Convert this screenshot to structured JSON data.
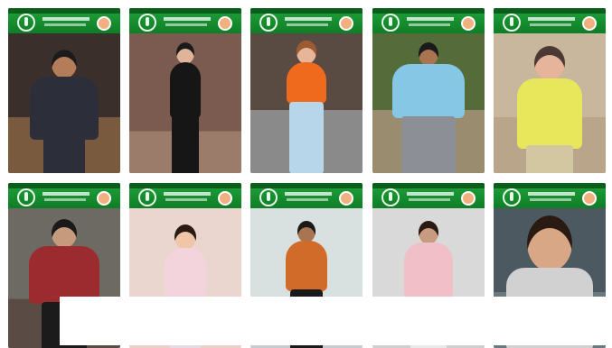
{
  "tiles": [
    {
      "id": "row1-col1",
      "bg": "#3a2f2a",
      "floor": "#7a5a3e",
      "skin": "#b57c5a",
      "hair": "#1b1b1b",
      "top": "#2c2f3a",
      "legs": "#2c2f3a"
    },
    {
      "id": "row1-col2",
      "bg": "#7b5a4f",
      "floor": "#9b7c6a",
      "skin": "#e0b49a",
      "hair": "#1a1a1a",
      "top": "#161616",
      "legs": "#161616"
    },
    {
      "id": "row1-col3",
      "bg": "#5a4b42",
      "floor": "#8a8a8a",
      "skin": "#e6b59a",
      "hair": "#9b5a30",
      "top": "#f06a1d",
      "legs": "#b8d6ea"
    },
    {
      "id": "row1-col4",
      "bg": "#556b3a",
      "floor": "#9a8c6f",
      "skin": "#a97452",
      "hair": "#1a1a1a",
      "top": "#86c7e6",
      "legs": "#8d8f97"
    },
    {
      "id": "row1-col5",
      "bg": "#c9b79d",
      "floor": "#b9a58a",
      "skin": "#e5b49a",
      "hair": "#4b3a33",
      "top": "#e8e65a",
      "legs": "#d2c7a0"
    },
    {
      "id": "row2-col1",
      "bg": "#6d6a64",
      "floor": "#5a4c44",
      "skin": "#c69a7c",
      "hair": "#1a1a1a",
      "top": "#9b2b2f",
      "legs": "#1b1b1b"
    },
    {
      "id": "row2-col2",
      "bg": "#ead5cf",
      "floor": "#e9d1c8",
      "skin": "#f0c5a8",
      "hair": "#2a1a14",
      "top": "#f3d3dc",
      "legs": "#e6dbe2"
    },
    {
      "id": "row2-col3",
      "bg": "#d8e0e0",
      "floor": "#c6cbd0",
      "skin": "#a97452",
      "hair": "#1a1a1a",
      "top": "#d06b2a",
      "legs": "#1a1a1a"
    },
    {
      "id": "row2-col4",
      "bg": "#d9d9d9",
      "floor": "#cfcfcf",
      "skin": "#c79b80",
      "hair": "#2a1a14",
      "top": "#f1bfc7",
      "legs": "#e9e9e9"
    },
    {
      "id": "row2-col5",
      "bg": "#4c5960",
      "floor": "#6b7880",
      "skin": "#d7a786",
      "hair": "#2a1a14",
      "top": "#d1d1d1",
      "legs": "#d1d1d1"
    }
  ]
}
